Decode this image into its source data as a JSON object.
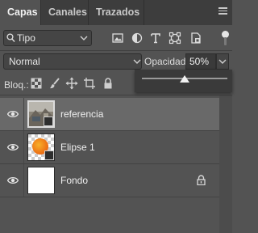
{
  "tabs": [
    {
      "label": "Capas",
      "active": true
    },
    {
      "label": "Canales",
      "active": false
    },
    {
      "label": "Trazados",
      "active": false
    }
  ],
  "filter": {
    "selected": "Tipo"
  },
  "blend": {
    "selected": "Normal",
    "opacity_label": "Opacidad:",
    "opacity_value": "50%",
    "opacity_percent": 50
  },
  "lock": {
    "label": "Bloq.:"
  },
  "layers": [
    {
      "name": "referencia",
      "selected": true,
      "visible": true,
      "locked": false
    },
    {
      "name": "Elipse 1",
      "selected": false,
      "visible": true,
      "locked": false
    },
    {
      "name": "Fondo",
      "selected": false,
      "visible": true,
      "locked": true
    }
  ],
  "colors": {
    "panel": "#535353",
    "tabbar": "#3d3d3d",
    "selected_row": "#696969",
    "ellipse": "#f08a1c"
  },
  "icons": [
    "search-icon",
    "chevron-down-icon",
    "image-filter-icon",
    "adjustment-filter-icon",
    "type-filter-icon",
    "shape-filter-icon",
    "smart-object-filter-icon",
    "panel-menu-icon",
    "lock-transparent-pixels-icon",
    "lock-image-pixels-icon",
    "lock-position-icon",
    "lock-artboard-icon",
    "lock-all-icon",
    "eye-icon",
    "lock-icon"
  ]
}
